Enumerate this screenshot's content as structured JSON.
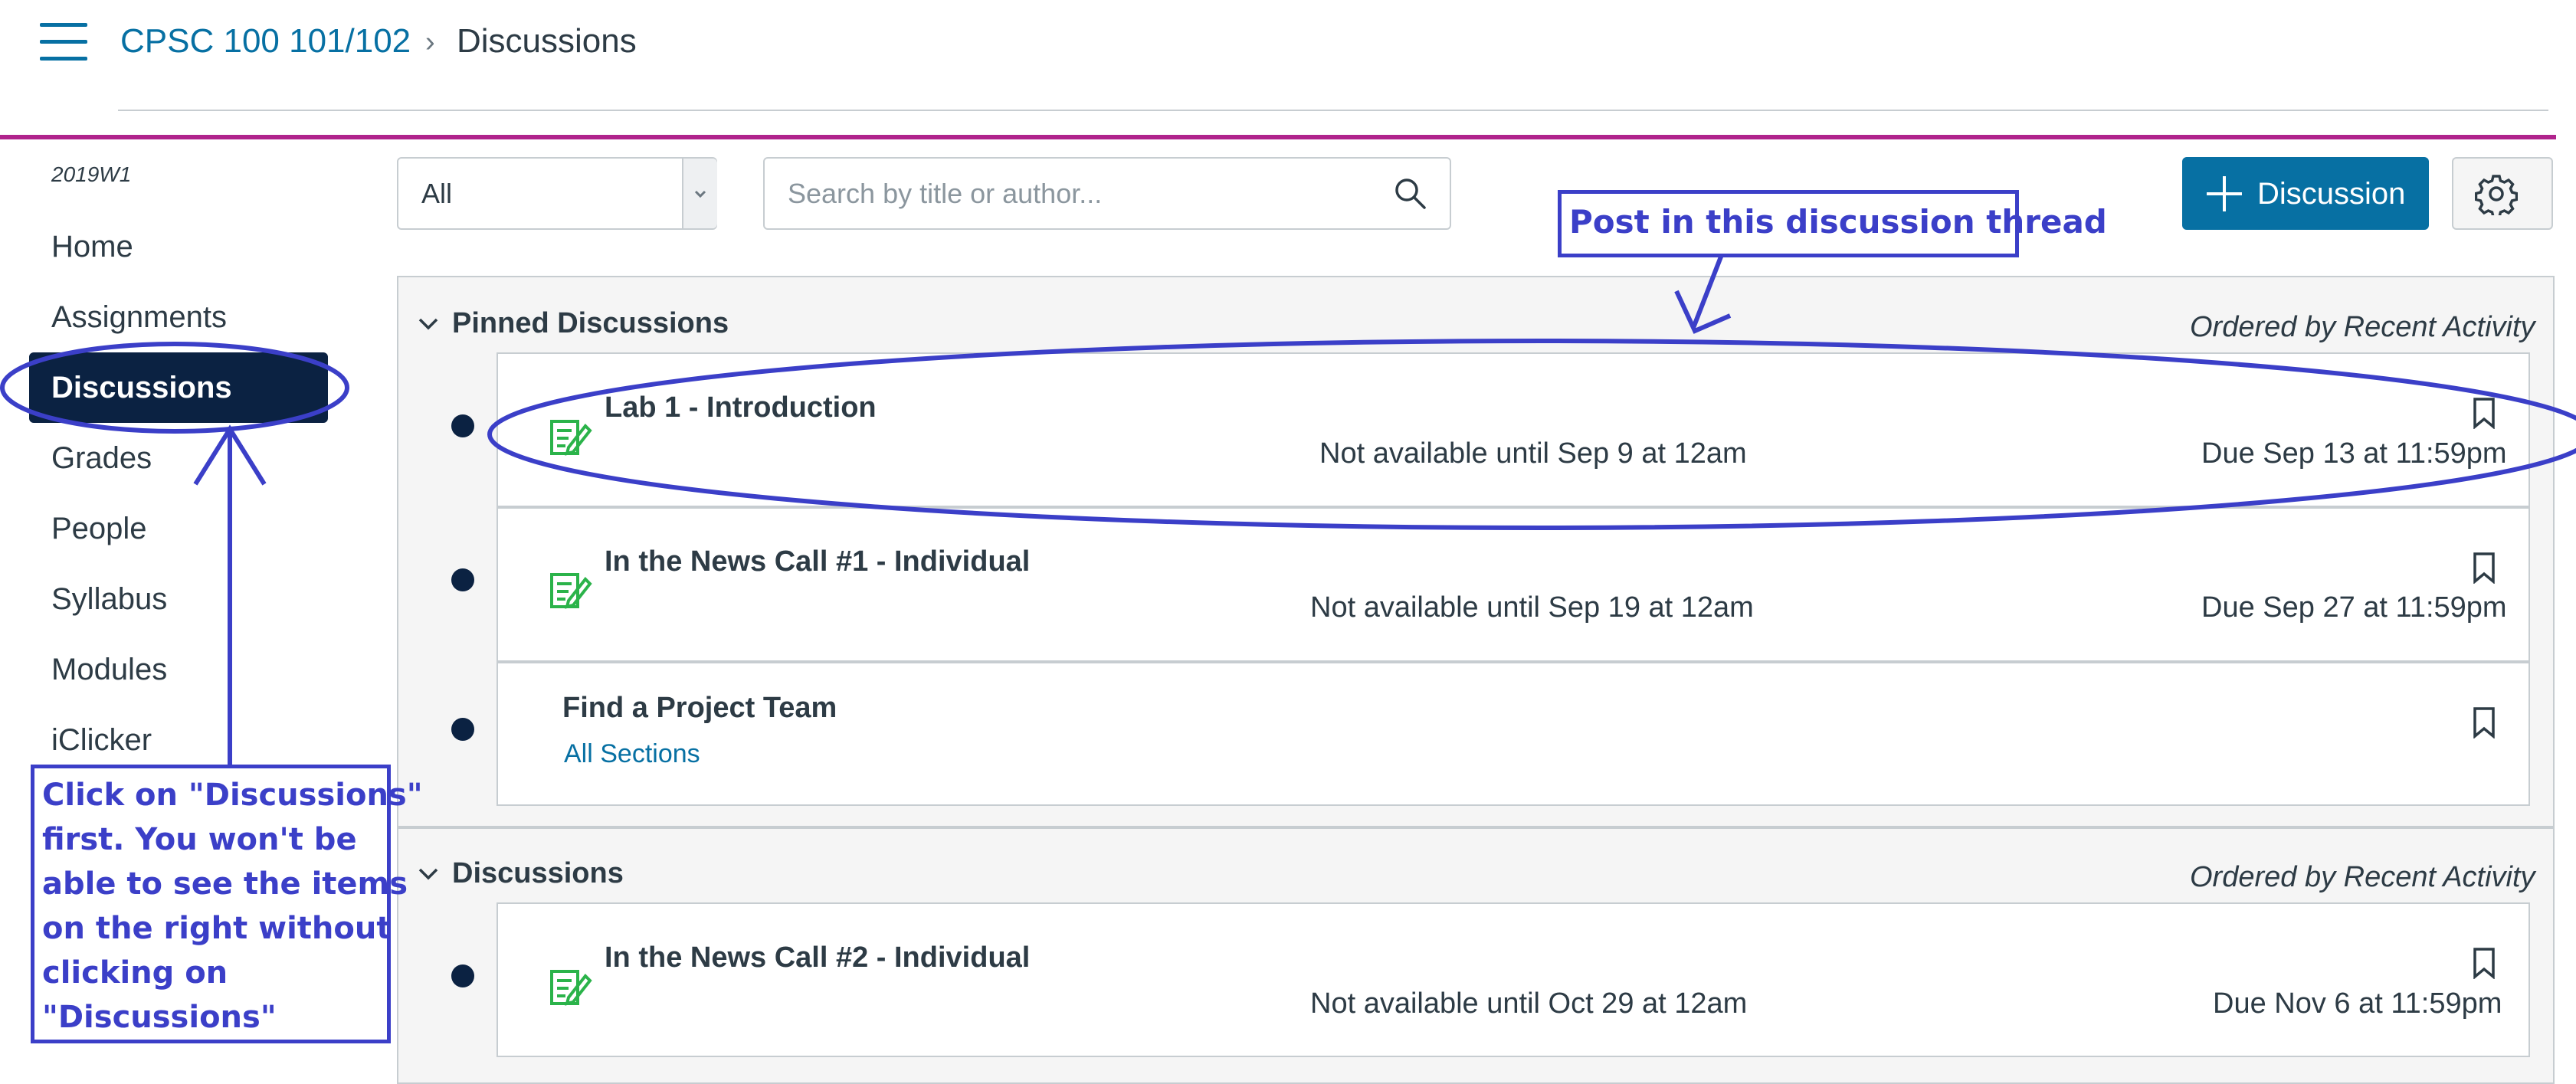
{
  "breadcrumb": {
    "course": "CPSC 100 101/102",
    "separator": "›",
    "page": "Discussions"
  },
  "sidebar": {
    "term": "2019W1",
    "items": [
      {
        "label": "Home",
        "active": false
      },
      {
        "label": "Assignments",
        "active": false
      },
      {
        "label": "Discussions",
        "active": true
      },
      {
        "label": "Grades",
        "active": false
      },
      {
        "label": "People",
        "active": false
      },
      {
        "label": "Syllabus",
        "active": false
      },
      {
        "label": "Modules",
        "active": false
      },
      {
        "label": "iClicker",
        "active": false
      }
    ]
  },
  "toolbar": {
    "filter_value": "All",
    "search_placeholder": "Search by title or author...",
    "add_label": "Discussion"
  },
  "pinned": {
    "title": "Pinned Discussions",
    "order": "Ordered by Recent Activity",
    "items": [
      {
        "title": "Lab 1 - Introduction",
        "availability": "Not available until Sep 9 at 12am",
        "due": "Due Sep 13 at 11:59pm"
      },
      {
        "title": "In the News Call #1 - Individual",
        "availability": "Not available until Sep 19 at 12am",
        "due": "Due Sep 27 at 11:59pm"
      },
      {
        "title": "Find a Project Team",
        "sections": "All Sections"
      }
    ]
  },
  "discussions": {
    "title": "Discussions",
    "order": "Ordered by Recent Activity",
    "items": [
      {
        "title": "In the News Call #2 - Individual",
        "availability": "Not available until Oct 29 at 12am",
        "due": "Due Nov 6 at 11:59pm"
      }
    ]
  },
  "annotations": {
    "top_callout": "Post in this discussion thread",
    "left_callout": [
      "Click on \"Discussions\"",
      "first. You won't be",
      "able to see the items",
      "on the right without",
      "clicking on",
      "\"Discussions\""
    ],
    "color": "#3b3fc8"
  },
  "colors": {
    "link": "#0770a3",
    "accent": "#b0238c",
    "nav_active": "#0b2242",
    "discussion_icon": "#2bb34a"
  }
}
